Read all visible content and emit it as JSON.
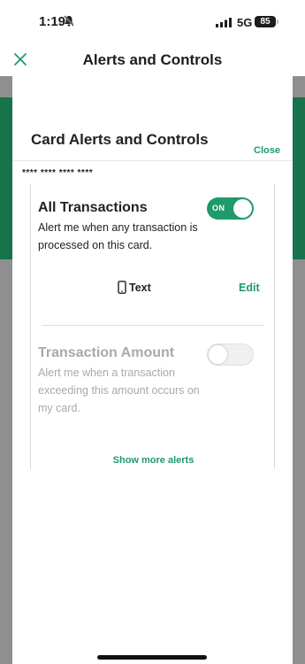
{
  "status_bar": {
    "time": "1:19",
    "network": "5G",
    "battery": "85"
  },
  "header": {
    "title": "Alerts and Controls"
  },
  "sheet": {
    "title": "Card Alerts and Controls",
    "close_label": "Close",
    "card_number": "**** **** **** ****"
  },
  "alerts": {
    "all_transactions": {
      "title": "All Transactions",
      "description": "Alert me when any transaction is processed on this card.",
      "toggle_label": "ON",
      "enabled": true,
      "delivery_method": "Text",
      "edit_label": "Edit"
    },
    "transaction_amount": {
      "title": "Transaction Amount",
      "description": "Alert me when a transaction exceeding this amount occurs on my card.",
      "toggle_label": "OFF",
      "enabled": false
    },
    "show_more_label": "Show more alerts"
  },
  "colors": {
    "accent": "#1f9a6a",
    "brand_green": "#17734b",
    "backdrop": "#8f8f8f"
  }
}
